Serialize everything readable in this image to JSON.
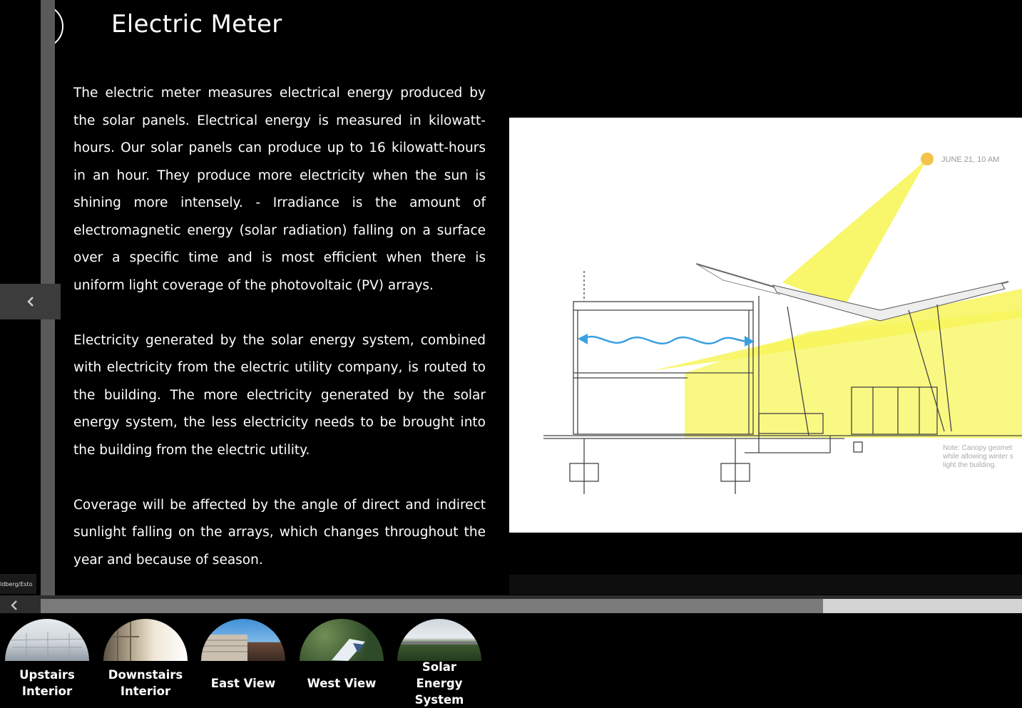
{
  "header": {
    "title": "Electric Meter"
  },
  "article": {
    "paragraphs": [
      "The electric meter measures electrical energy produced by the solar panels. Electrical energy is measured in kilowatt-hours.  Our solar panels can produce up to 16 kilowatt-hours in an hour.  They produce more electricity when the sun is shining more intensely. - Irradiance is the amount of electromagnetic energy (solar radiation) falling on a surface over a specific time and is  most efficient when there is uniform light coverage of the photovoltaic (PV) arrays.",
      "Electricity generated by the solar energy system, combined with electricity from the electric utility company, is routed to the building.  The more electricity generated by the solar energy system, the less electricity needs to be brought into the building from the electric utility.",
      "Coverage will be affected by the angle of direct and indirect sunlight falling on the arrays, which changes throughout the year and because of season."
    ]
  },
  "diagram": {
    "sun_label": "JUNE 21, 10 AM",
    "note_lines": [
      "Note: Canopy geomet",
      "while allowing winter s",
      "light the building."
    ]
  },
  "photo_credit": "ldberg/Esto",
  "thumbnails": [
    {
      "line1": "Upstairs",
      "line2": "Interior"
    },
    {
      "line1": "Downstairs",
      "line2": "Interior"
    },
    {
      "line1": "East View",
      "line2": ""
    },
    {
      "line1": "West View",
      "line2": ""
    },
    {
      "line1": "Solar Energy",
      "line2": "System"
    }
  ],
  "colors": {
    "sun": "#f5c24a",
    "light": "#f7f55a",
    "airflow": "#3aa0e0",
    "scroll_thumb": "#7a7a7a"
  }
}
